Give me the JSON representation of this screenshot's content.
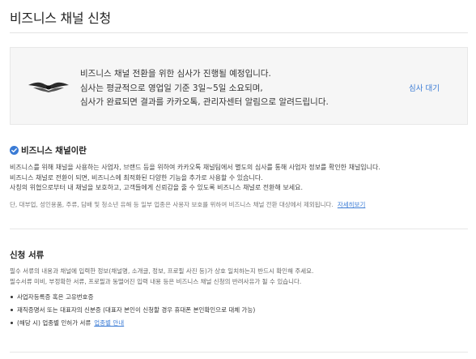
{
  "page": {
    "title": "비즈니스 채널 신청"
  },
  "status": {
    "lines": [
      "비즈니스 채널 전환을 위한 심사가 진행될 예정입니다.",
      "심사는 평균적으로 영업일 기준 3일~5일 소요되며,",
      "심사가 완료되면 결과를 카카오톡, 관리자센터 알림으로 알려드립니다."
    ],
    "state_label": "심사 대기",
    "logo_icon": "winged-logo-icon"
  },
  "about": {
    "heading": "비즈니스 채널이란",
    "heading_icon": "check-badge-icon",
    "paragraphs": [
      "비즈니스를 위해 채널을 사용하는 사업자, 브랜드 등을 위하여 카카오톡 채널팀에서 별도의 심사를 통해 사업자 정보를 확인한 채널입니다.",
      "비즈니스 채널로 전환이 되면, 비즈니스에 최적화된 다양한 기능을 추가로 사용할 수 있습니다.",
      "사칭의 위협으로부터 내 채널을 보호하고, 고객들에게 신뢰감을 줄 수 있도록 비즈니스 채널로 전환해 보세요."
    ],
    "note": "단, 대부업, 성인용품, 주류, 담배 및 청소년 유해 등 일부 업종은 사용자 보호를 위하여 비즈니스 채널 전환 대상에서 제외됩니다.",
    "note_link": "자세히보기"
  },
  "docs": {
    "heading": "신청 서류",
    "desc": [
      "필수 서류의 내용과 채널에 입력한 정보(채널명, 소개글, 정보, 프로필 사진 등)가 상호 일치하는지 반드시 확인해 주세요.",
      "필수서류 미비, 부정확한 서류, 프로필과 동떨어진 입력 내용 등은 비즈니스 채널 신청의 반려사유가 될 수 있습니다."
    ],
    "items": [
      {
        "text": "사업자등록증 혹은 고유번호증",
        "link": ""
      },
      {
        "text": "재직증명서 또는 대표자의 신분증 (대표자 본인이 신청할 경우 휴대폰 본인확인으로 대체 가능)",
        "link": ""
      },
      {
        "text": "(해당 시) 업종별 인허가 서류",
        "link": "업종별 안내"
      }
    ]
  },
  "colors": {
    "accent": "#3a7bd5",
    "badge": "#3a7bd5",
    "panel_bg": "#f6f6f6"
  }
}
